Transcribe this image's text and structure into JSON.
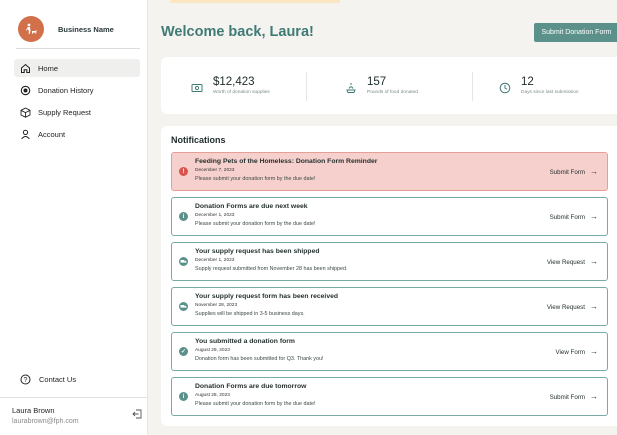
{
  "brand": {
    "name": "Business Name"
  },
  "sidebar": {
    "items": [
      {
        "label": "Home",
        "icon": "home-icon",
        "active": true
      },
      {
        "label": "Donation History",
        "icon": "history-icon",
        "active": false
      },
      {
        "label": "Supply Request",
        "icon": "box-icon",
        "active": false
      },
      {
        "label": "Account",
        "icon": "user-icon",
        "active": false
      }
    ],
    "contact_label": "Contact Us",
    "user": {
      "name": "Laura Brown",
      "email": "laurabrown@fph.com"
    }
  },
  "header": {
    "welcome": "Welcome back, Laura!",
    "submit_label": "Submit Donation Form"
  },
  "stats": [
    {
      "value": "$12,423",
      "label": "Worth of donation supplies",
      "icon": "money-icon"
    },
    {
      "value": "157",
      "label": "Pounds of food donated",
      "icon": "food-icon"
    },
    {
      "value": "12",
      "label": "Days since last submission",
      "icon": "clock-icon"
    }
  ],
  "notifications": {
    "title": "Notifications",
    "items": [
      {
        "title": "Feeding Pets of the Homeless: Donation Form Reminder",
        "date": "December 7, 2023",
        "message": "Please submit your donation form by the due date!",
        "action": "Submit Form",
        "type": "alert",
        "icon": "alert-icon",
        "icon_color": "#d9534f"
      },
      {
        "title": "Donation Forms are due next week",
        "date": "December 1, 2023",
        "message": "Please submit your donation form by the due date!",
        "action": "Submit Form",
        "type": "normal",
        "icon": "info-icon",
        "icon_color": "#5b918a"
      },
      {
        "title": "Your supply request has been shipped",
        "date": "December 1, 2023",
        "message": "Supply request submitted from November 28 has been shipped.",
        "action": "View Request",
        "type": "normal",
        "icon": "truck-icon",
        "icon_color": "#5b918a"
      },
      {
        "title": "Your supply request form has been received",
        "date": "November 28, 2023",
        "message": "Supplies will be shipped in 3-5 business days.",
        "action": "View Request",
        "type": "normal",
        "icon": "truck-icon",
        "icon_color": "#5b918a"
      },
      {
        "title": "You submitted a donation form",
        "date": "August 29, 2023",
        "message": "Donation form has been submitted for Q3. Thank you!",
        "action": "View Form",
        "type": "normal",
        "icon": "check-icon",
        "icon_color": "#5b918a"
      },
      {
        "title": "Donation Forms are due tomorrow",
        "date": "August 28, 2023",
        "message": "Please submit your donation form by the due date!",
        "action": "Submit Form",
        "type": "normal",
        "icon": "info-icon",
        "icon_color": "#5b918a"
      }
    ]
  },
  "colors": {
    "accent": "#5b918a",
    "heading": "#3f7a75",
    "alert_bg": "#f6d0cc",
    "logo": "#d2704a"
  }
}
